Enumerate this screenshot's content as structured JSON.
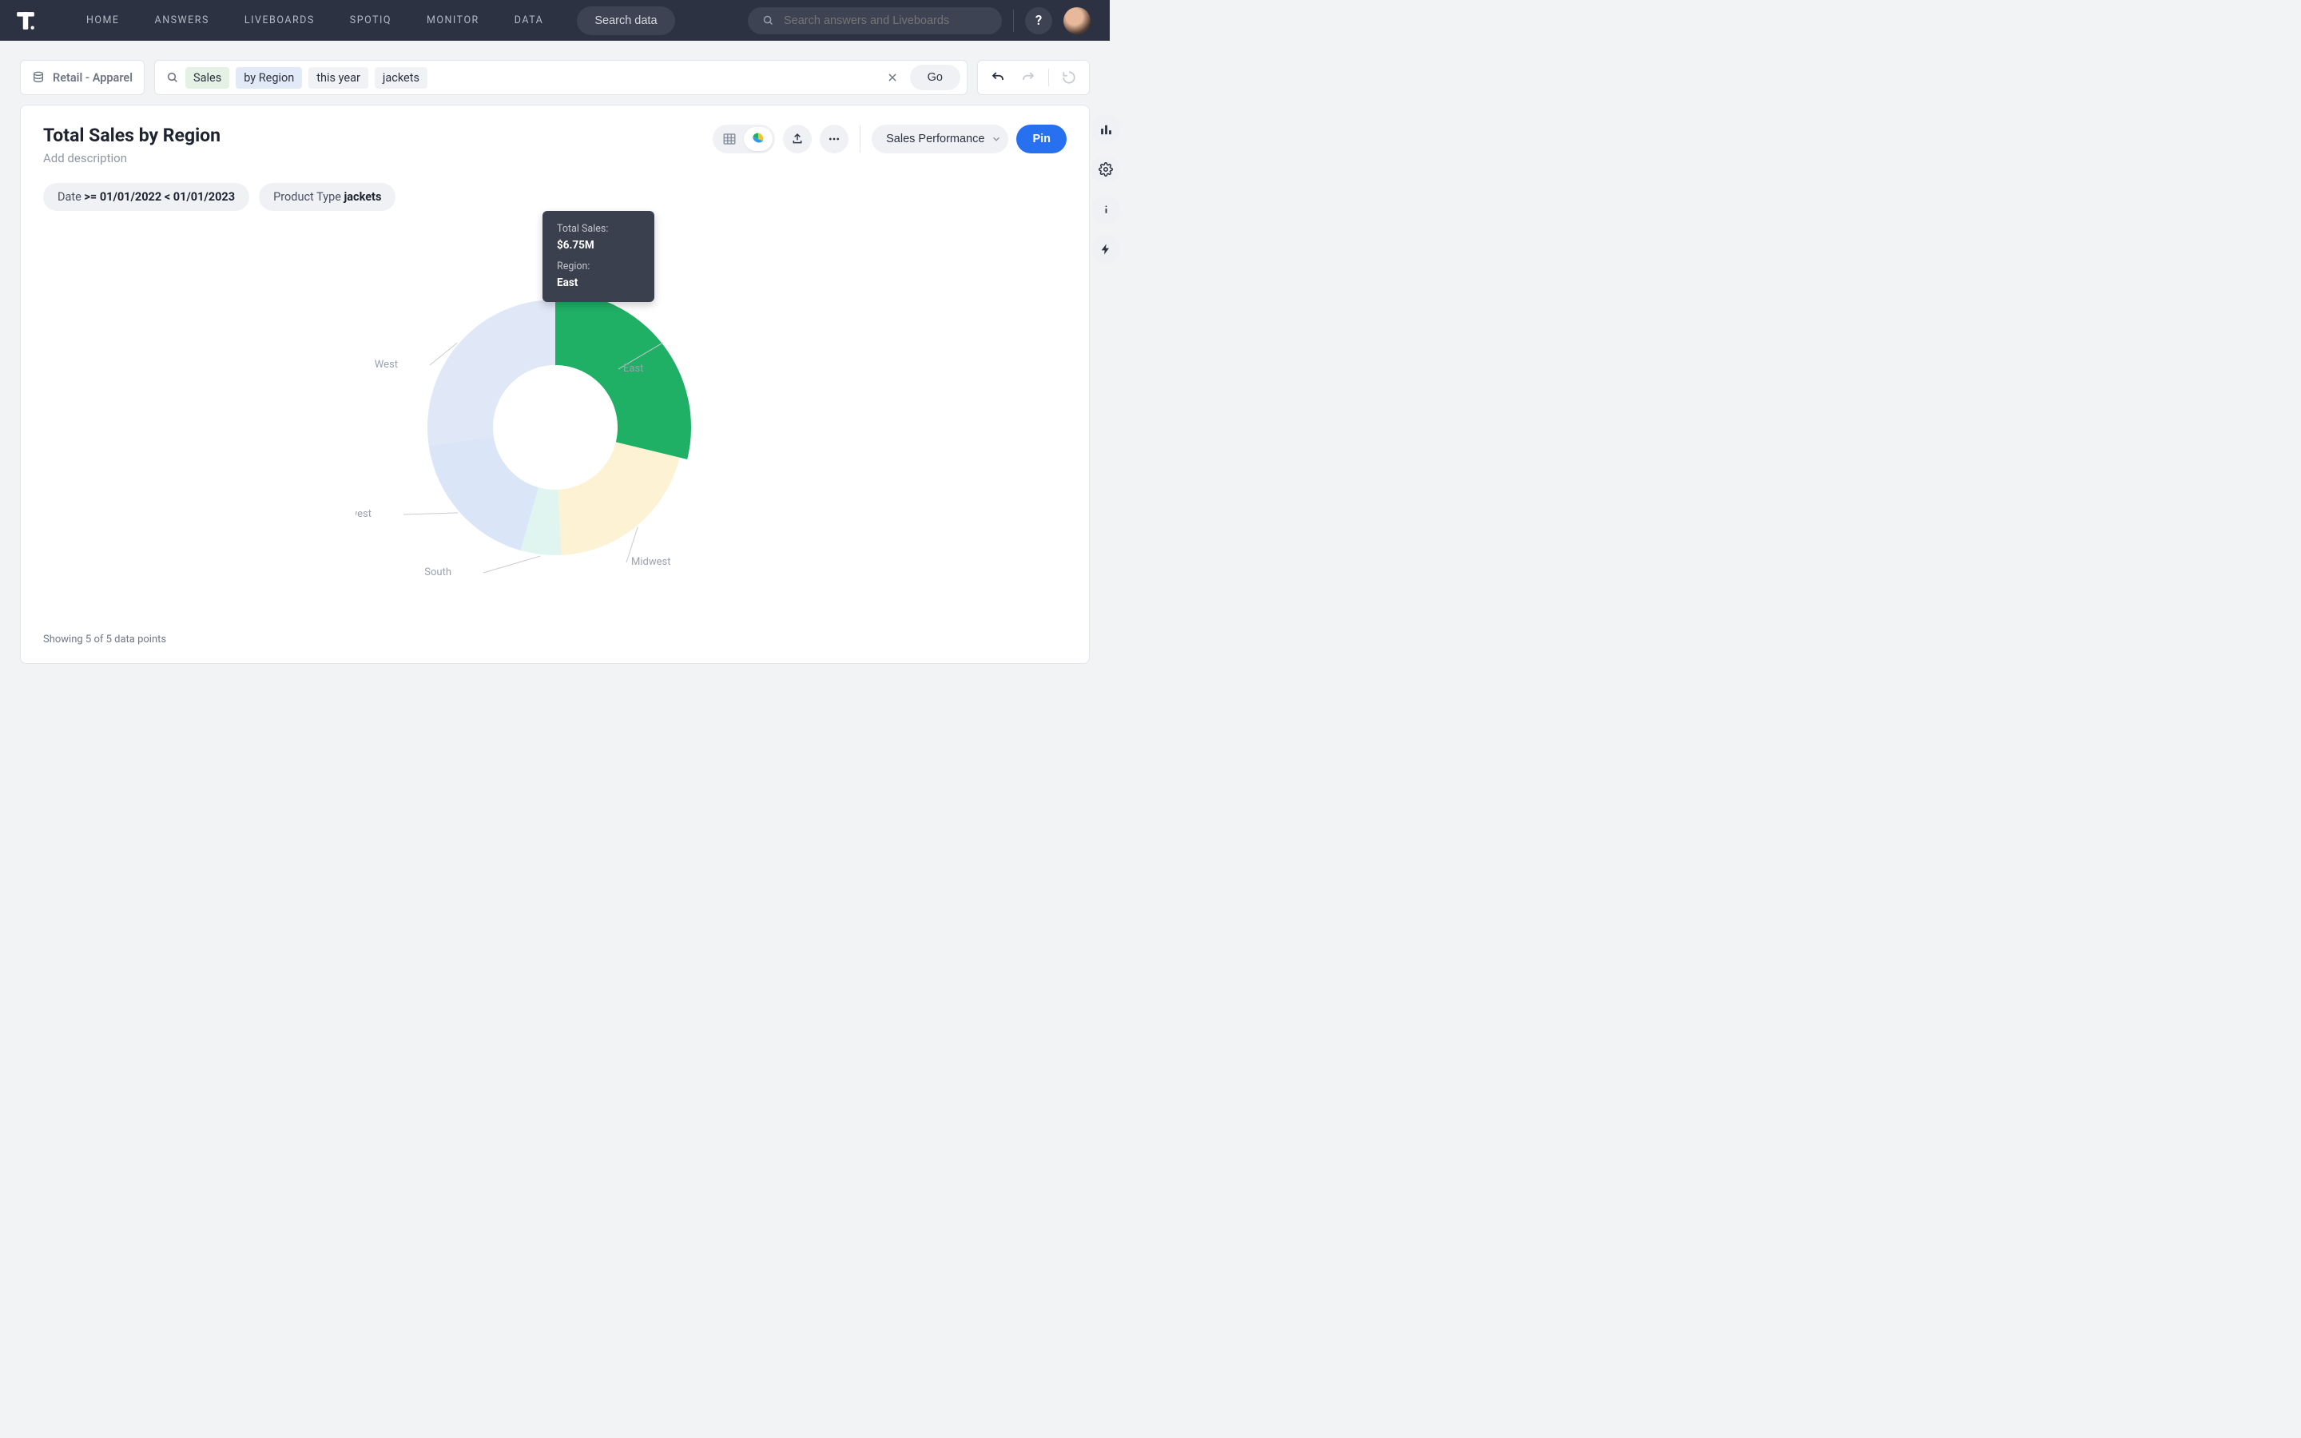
{
  "nav": {
    "items": [
      "HOME",
      "ANSWERS",
      "LIVEBOARDS",
      "SPOTIQ",
      "MONITOR",
      "DATA"
    ],
    "search_data_btn": "Search data",
    "global_search_placeholder": "Search answers and Liveboards"
  },
  "datasource": {
    "label": "Retail - Apparel"
  },
  "query": {
    "tokens": [
      "Sales",
      "by Region",
      "this year",
      "jackets"
    ],
    "go_label": "Go"
  },
  "answer": {
    "title": "Total Sales by Region",
    "description_placeholder": "Add description",
    "liveboard_dropdown": "Sales Performance",
    "pin_label": "Pin"
  },
  "filters": [
    {
      "label": "Date ",
      "value": ">= 01/01/2022 < 01/01/2023"
    },
    {
      "label": "Product Type ",
      "value": "jackets"
    }
  ],
  "tooltip": {
    "metric_label": "Total Sales:",
    "metric_value": "$6.75M",
    "dim_label": "Region:",
    "dim_value": "East"
  },
  "footer": "Showing 5 of 5 data points",
  "chart_data": {
    "type": "pie",
    "subtype": "donut",
    "title": "Total Sales by Region",
    "categories": [
      "East",
      "Midwest",
      "South",
      "Southwest",
      "West"
    ],
    "series": [
      {
        "name": "Total Sales",
        "values": [
          6750000,
          4800000,
          1200000,
          4300000,
          6400000
        ]
      }
    ],
    "highlighted_category": "East",
    "colors": {
      "East": "#1fb066",
      "Midwest": "#fbe7b1",
      "South": "#c9ede3",
      "Southwest": "#bcd2f1",
      "West": "#c7d3ef"
    },
    "value_format": "$,.2sM"
  }
}
